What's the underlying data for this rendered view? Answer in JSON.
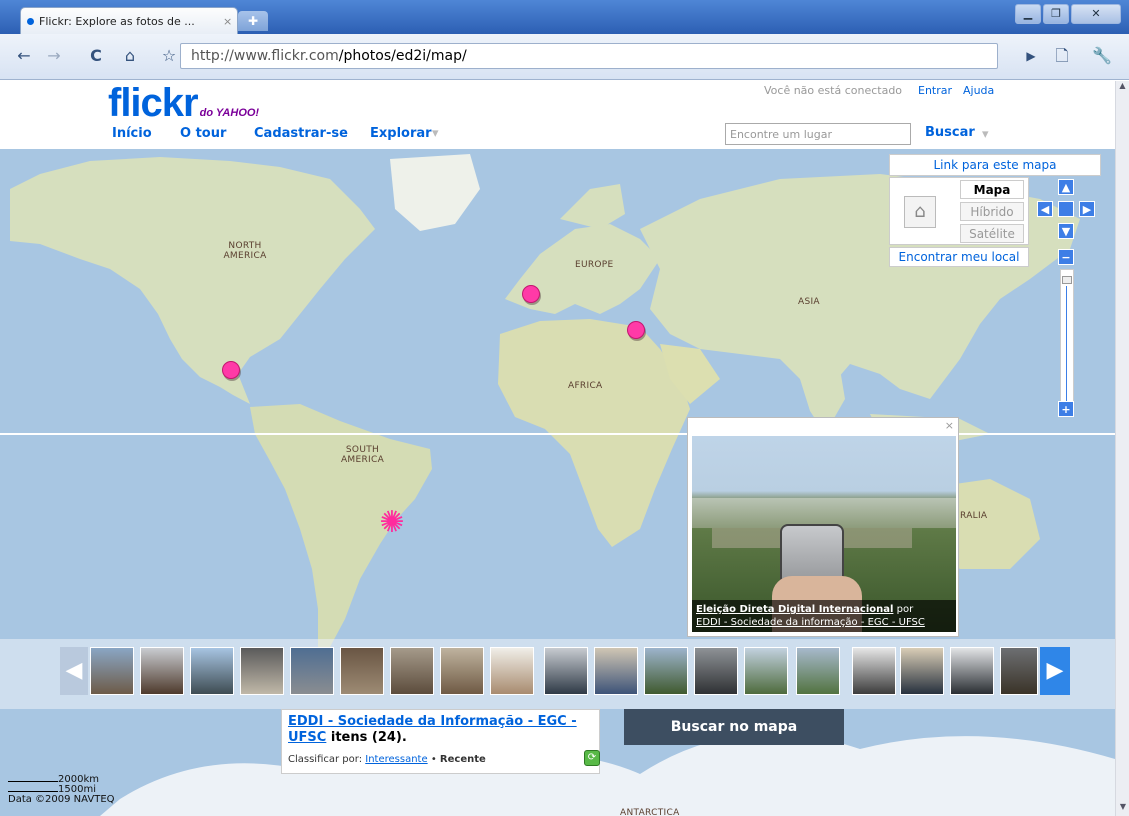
{
  "browser": {
    "tab_title": "Flickr: Explore as fotos de ...",
    "tab_close": "×",
    "url_host": "http://www.flickr.com",
    "url_path": "/photos/ed2i/map/"
  },
  "header": {
    "logo_main": "flickr",
    "logo_sub": "do YAHOO!",
    "status": "Você não está conectado",
    "login": "Entrar",
    "help": "Ajuda",
    "nav": [
      "Início",
      "O tour",
      "Cadastrar-se",
      "Explorar"
    ],
    "search_placeholder": "Encontre um lugar",
    "search_button": "Buscar"
  },
  "map": {
    "region_labels": [
      "NORTH AMERICA",
      "EUROPE",
      "ASIA",
      "AFRICA",
      "SOUTH AMERICA",
      "RALIA",
      "ANTARCTICA"
    ],
    "controls": {
      "link": "Link para este mapa",
      "types": [
        "Mapa",
        "Híbrido",
        "Satélite"
      ],
      "find_location": "Encontrar meu local"
    },
    "popup": {
      "title": "Eleição Direta Digital Internacional",
      "by": "por",
      "owner": "EDDI - Sociedade da informação - EGC - UFSC",
      "close": "×"
    },
    "scale": [
      "2000km",
      "1500mi"
    ],
    "copyright": "Data ©2009 NAVTEQ"
  },
  "info": {
    "owner_title": "EDDI - Sociedade da Informação - EGC - UFSC",
    "count": "itens (24).",
    "sort_label": "Classificar por:",
    "sort_options": [
      "Interessante",
      "Recente"
    ],
    "search_in_map": "Buscar no mapa"
  },
  "colors": {
    "brand_blue": "#0063dc",
    "brand_pink": "#ff0084",
    "ocean": "#a8c6e2",
    "land": "#d4dcb8"
  }
}
